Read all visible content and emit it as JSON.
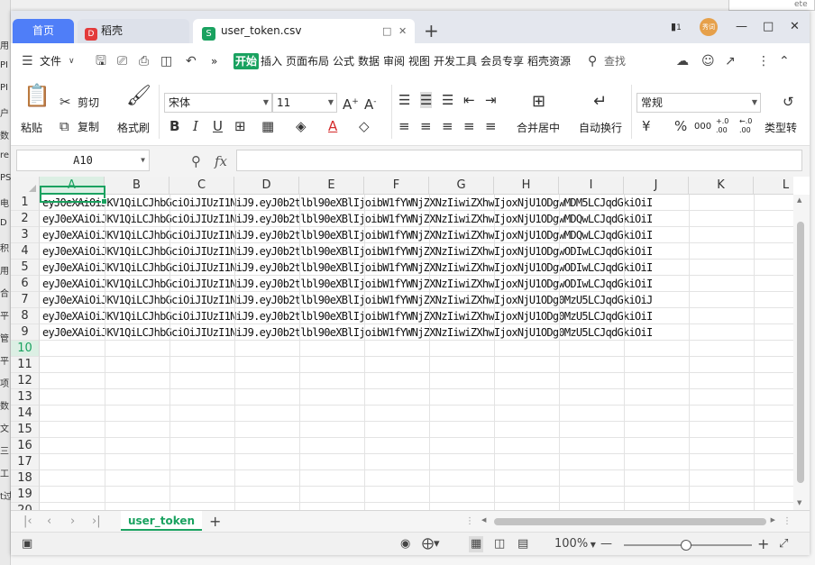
{
  "left_edge_fragments": [
    "用",
    "PI",
    "PI",
    "户",
    "数",
    "re",
    "PS",
    "电",
    "D",
    "积",
    "用",
    "合",
    "平",
    "管",
    "平",
    "项",
    "数",
    "文",
    "三",
    "工",
    "t过"
  ],
  "top_peek": "ete",
  "tabs": {
    "home": "首页",
    "docer": "稻壳",
    "docer_logo": "D",
    "file": "user_token.csv",
    "file_icon": "S",
    "new_tab": "+"
  },
  "title_icons": {
    "window_badge": "1",
    "avatar_text": "秀词"
  },
  "menu": {
    "file": "文件",
    "more": "»",
    "start": "开始",
    "tabs": [
      "插入",
      "页面布局",
      "公式",
      "数据",
      "审阅",
      "视图",
      "开发工具",
      "会员专享",
      "稻壳资源"
    ],
    "search": "查找"
  },
  "ribbon": {
    "paste": "粘贴",
    "cut": "剪切",
    "copy": "复制",
    "format_painter": "格式刷",
    "font_name": "宋体",
    "font_size": "11",
    "merge_center": "合并居中",
    "wrap_text": "自动换行",
    "number_format": "常规",
    "currency": "¥",
    "percent": "%",
    "thousands": "000",
    "inc_decimal": "+.0 .00",
    "dec_decimal": "←.0 .00",
    "cell_type": "类型转"
  },
  "formula_bar": {
    "name_box": "A10",
    "fx": "fx",
    "formula": ""
  },
  "columns": [
    "A",
    "B",
    "C",
    "D",
    "E",
    "F",
    "G",
    "H",
    "I",
    "J",
    "K",
    "L"
  ],
  "selected_column": "A",
  "row_numbers": [
    "1",
    "2",
    "3",
    "4",
    "5",
    "6",
    "7",
    "8",
    "9",
    "10",
    "11",
    "12",
    "13",
    "14",
    "15",
    "16",
    "17",
    "18",
    "19",
    "20"
  ],
  "selected_row": "10",
  "rows": [
    "eyJ0eXAiOiJKV1QiLCJhbGciOiJIUzI1NiJ9.eyJ0b2tlbl90eXBlIjoibW1fYWNjZXNzIiwiZXhwIjoxNjU1ODgwMDM5LCJqdGkiOiI",
    "eyJ0eXAiOiJKV1QiLCJhbGciOiJIUzI1NiJ9.eyJ0b2tlbl90eXBlIjoibW1fYWNjZXNzIiwiZXhwIjoxNjU1ODgwMDQwLCJqdGkiOiI",
    "eyJ0eXAiOiJKV1QiLCJhbGciOiJIUzI1NiJ9.eyJ0b2tlbl90eXBlIjoibW1fYWNjZXNzIiwiZXhwIjoxNjU1ODgwMDQwLCJqdGkiOiI",
    "eyJ0eXAiOiJKV1QiLCJhbGciOiJIUzI1NiJ9.eyJ0b2tlbl90eXBlIjoibW1fYWNjZXNzIiwiZXhwIjoxNjU1ODgwODIwLCJqdGkiOiI",
    "eyJ0eXAiOiJKV1QiLCJhbGciOiJIUzI1NiJ9.eyJ0b2tlbl90eXBlIjoibW1fYWNjZXNzIiwiZXhwIjoxNjU1ODgwODIwLCJqdGkiOiI",
    "eyJ0eXAiOiJKV1QiLCJhbGciOiJIUzI1NiJ9.eyJ0b2tlbl90eXBlIjoibW1fYWNjZXNzIiwiZXhwIjoxNjU1ODgwODIwLCJqdGkiOiI",
    "eyJ0eXAiOiJKV1QiLCJhbGciOiJIUzI1NiJ9.eyJ0b2tlbl90eXBlIjoibW1fYWNjZXNzIiwiZXhwIjoxNjU1ODg0MzU5LCJqdGkiOiJ",
    "eyJ0eXAiOiJKV1QiLCJhbGciOiJIUzI1NiJ9.eyJ0b2tlbl90eXBlIjoibW1fYWNjZXNzIiwiZXhwIjoxNjU1ODg0MzU5LCJqdGkiOiI",
    "eyJ0eXAiOiJKV1QiLCJhbGciOiJIUzI1NiJ9.eyJ0b2tlbl90eXBlIjoibW1fYWNjZXNzIiwiZXhwIjoxNjU1ODg0MzU5LCJqdGkiOiI"
  ],
  "sheet": {
    "name": "user_token",
    "add": "+"
  },
  "status": {
    "zoom": "100%",
    "zoom_level": 0.5
  },
  "colors": {
    "accent": "#1aa260",
    "home_tab": "#4f7ef8"
  }
}
